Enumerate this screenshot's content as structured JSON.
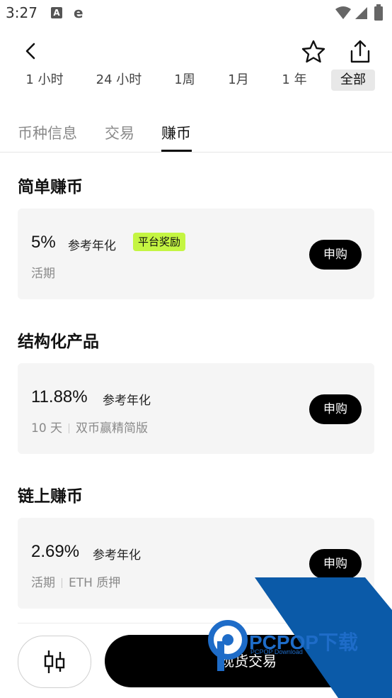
{
  "status": {
    "time": "3:27",
    "a_icon": "A",
    "e_icon": "e"
  },
  "ranges": [
    "1 小时",
    "24 小时",
    "1周",
    "1月",
    "1 年",
    "全部"
  ],
  "tabs": [
    "币种信息",
    "交易",
    "赚币"
  ],
  "active_tab": "赚币",
  "sections": [
    {
      "title": "简单赚币",
      "rate": "5%",
      "ref": "参考年化",
      "badge": "平台奖励",
      "term": "活期",
      "detail": "",
      "button": "申购"
    },
    {
      "title": "结构化产品",
      "rate": "11.88%",
      "ref": "参考年化",
      "term": "10 天",
      "detail": "双币赢精简版",
      "button": "申购"
    },
    {
      "title": "链上赚币",
      "rate": "2.69%",
      "ref": "参考年化",
      "term": "活期",
      "detail": "ETH 质押",
      "button": "申购"
    }
  ],
  "bottom": {
    "trade_label": "现货交易"
  },
  "watermark": {
    "brand": "PCPOP下载",
    "sub": "PCPOP Download"
  },
  "colors": {
    "badge": "#c4f542",
    "button": "#000000",
    "watermark": "#0b5aa8"
  },
  "icons": [
    "back-arrow-icon",
    "star-icon",
    "share-icon",
    "candlestick-icon",
    "wifi-icon",
    "signal-icon",
    "battery-icon"
  ]
}
